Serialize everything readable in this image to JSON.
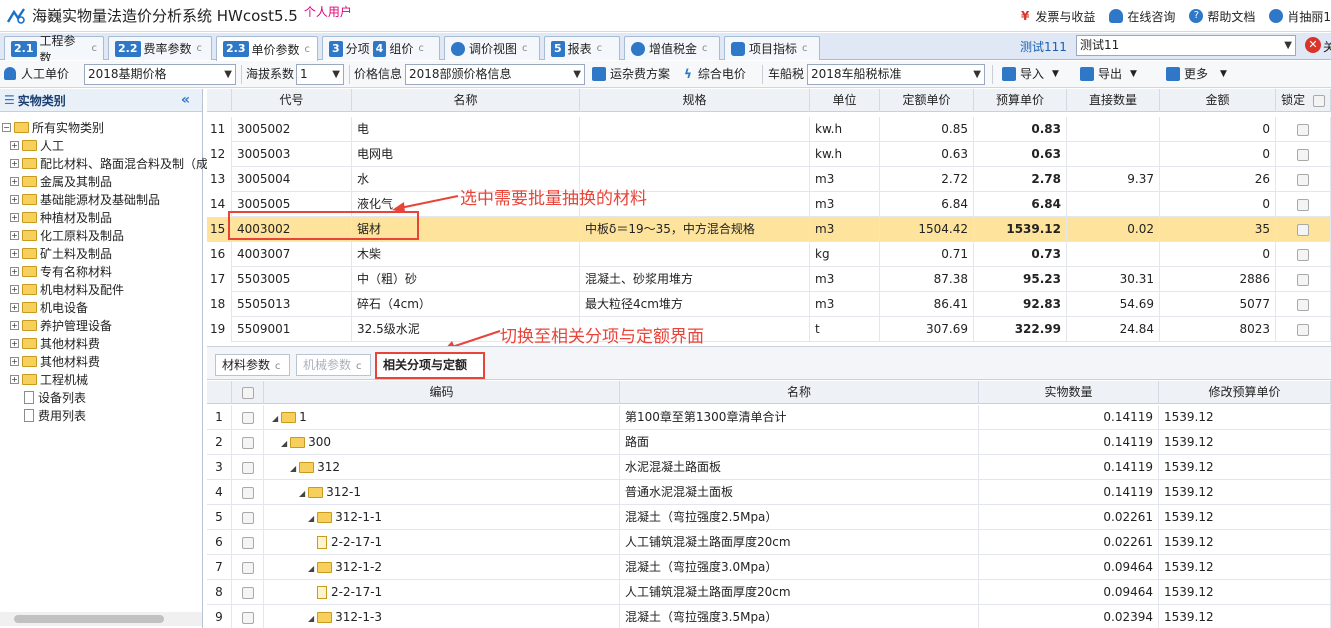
{
  "titlebar": {
    "app_title": "海巍实物量法造价分析系统 HWcost5.5",
    "user_type": "个人用户",
    "links": [
      {
        "label": "发票与收益",
        "icon": "yen-icon"
      },
      {
        "label": "在线咨询",
        "icon": "chat-icon"
      },
      {
        "label": "帮助文档",
        "icon": "help-icon"
      },
      {
        "label": "肖抽丽1",
        "icon": "user-icon"
      }
    ]
  },
  "tabs": [
    {
      "num": "2.1",
      "label": "工程参数",
      "ref": "c"
    },
    {
      "num": "2.2",
      "label": "费率参数",
      "ref": "c"
    },
    {
      "num": "2.3",
      "label": "单价参数",
      "ref": "c"
    },
    {
      "num": "3",
      "label": "分项",
      "num2": "4",
      "label2": "组价",
      "ref": "c"
    },
    {
      "label": "调价视图",
      "ref": "c"
    },
    {
      "num": "5",
      "label": "报表",
      "ref": "c"
    },
    {
      "label": "增值税金",
      "ref": "c"
    },
    {
      "label": "项目指标",
      "ref": "c"
    }
  ],
  "project": {
    "label": "测试111",
    "value": "测试11",
    "close_label": "关"
  },
  "toolbar": {
    "labor_price_label": "人工单价",
    "labor_price_value": "2018基期价格",
    "altitude_label": "海拔系数",
    "altitude_value": "1",
    "price_info_label": "价格信息",
    "price_info_value": "2018部颁价格信息",
    "transport_label": "运杂费方案",
    "power_label": "综合电价",
    "vehicle_tax_label": "车船税",
    "vehicle_tax_value": "2018车船税标准",
    "import_label": "导入",
    "export_label": "导出",
    "more_label": "更多"
  },
  "left_panel": {
    "header": "实物类别",
    "tree": [
      {
        "label": "所有实物类别",
        "level": 0,
        "type": "root"
      },
      {
        "label": "人工",
        "level": 1,
        "type": "folder"
      },
      {
        "label": "配比材料、路面混合料及制（成",
        "level": 1,
        "type": "folder"
      },
      {
        "label": "金属及其制品",
        "level": 1,
        "type": "folder"
      },
      {
        "label": "基础能源材及基础制品",
        "level": 1,
        "type": "folder"
      },
      {
        "label": "种植材及制品",
        "level": 1,
        "type": "folder"
      },
      {
        "label": "化工原料及制品",
        "level": 1,
        "type": "folder"
      },
      {
        "label": "矿土料及制品",
        "level": 1,
        "type": "folder"
      },
      {
        "label": "专有名称材料",
        "level": 1,
        "type": "folder"
      },
      {
        "label": "机电材料及配件",
        "level": 1,
        "type": "folder"
      },
      {
        "label": "机电设备",
        "level": 1,
        "type": "folder"
      },
      {
        "label": "养护管理设备",
        "level": 1,
        "type": "folder"
      },
      {
        "label": "其他材料费",
        "level": 1,
        "type": "folder"
      },
      {
        "label": "其他材料费",
        "level": 1,
        "type": "folder"
      },
      {
        "label": "工程机械",
        "level": 1,
        "type": "folder"
      },
      {
        "label": "设备列表",
        "level": 1,
        "type": "doc"
      },
      {
        "label": "费用列表",
        "level": 1,
        "type": "doc"
      }
    ]
  },
  "upper_grid": {
    "columns": [
      "代号",
      "名称",
      "规格",
      "单位",
      "定额单价",
      "预算单价",
      "直接数量",
      "金额",
      "锁定"
    ],
    "rows": [
      {
        "idx": "11",
        "code": "3005002",
        "name": "电",
        "spec": "",
        "unit": "kw.h",
        "quota": "0.85",
        "budget": "0.83",
        "qty": "",
        "amount": "0"
      },
      {
        "idx": "12",
        "code": "3005003",
        "name": "电网电",
        "spec": "",
        "unit": "kw.h",
        "quota": "0.63",
        "budget": "0.63",
        "qty": "",
        "amount": "0"
      },
      {
        "idx": "13",
        "code": "3005004",
        "name": "水",
        "spec": "",
        "unit": "m3",
        "quota": "2.72",
        "budget": "2.78",
        "qty": "9.37",
        "amount": "26"
      },
      {
        "idx": "14",
        "code": "3005005",
        "name": "液化气",
        "spec": "",
        "unit": "m3",
        "quota": "6.84",
        "budget": "6.84",
        "qty": "",
        "amount": "0"
      },
      {
        "idx": "15",
        "code": "4003002",
        "name": "锯材",
        "spec": "中板δ＝19～35，中方混合规格",
        "unit": "m3",
        "quota": "1504.42",
        "budget": "1539.12",
        "qty": "0.02",
        "amount": "35"
      },
      {
        "idx": "16",
        "code": "4003007",
        "name": "木柴",
        "spec": "",
        "unit": "kg",
        "quota": "0.71",
        "budget": "0.73",
        "qty": "",
        "amount": "0"
      },
      {
        "idx": "17",
        "code": "5503005",
        "name": "中（粗）砂",
        "spec": "混凝土、砂浆用堆方",
        "unit": "m3",
        "quota": "87.38",
        "budget": "95.23",
        "qty": "30.31",
        "amount": "2886"
      },
      {
        "idx": "18",
        "code": "5505013",
        "name": "碎石（4cm）",
        "spec": "最大粒径4cm堆方",
        "unit": "m3",
        "quota": "86.41",
        "budget": "92.83",
        "qty": "54.69",
        "amount": "5077"
      },
      {
        "idx": "19",
        "code": "5509001",
        "name": "32.5级水泥",
        "spec": "",
        "unit": "t",
        "quota": "307.69",
        "budget": "322.99",
        "qty": "24.84",
        "amount": "8023"
      }
    ]
  },
  "annotations": {
    "select_note": "选中需要批量抽换的材料",
    "switch_note": "切换至相关分项与定额界面"
  },
  "lower_tabs": [
    {
      "label": "材料参数",
      "ref": "c",
      "state": "normal"
    },
    {
      "label": "机械参数",
      "ref": "c",
      "state": "disabled"
    },
    {
      "label": "相关分项与定额",
      "ref": "",
      "state": "active"
    }
  ],
  "lower_grid": {
    "columns": [
      "编码",
      "名称",
      "实物数量",
      "修改预算单价"
    ],
    "rows": [
      {
        "idx": "1",
        "code": "1",
        "name": "第100章至第1300章清单合计",
        "qty": "0.14119",
        "price": "1539.12",
        "depth": 0,
        "type": "folder"
      },
      {
        "idx": "2",
        "code": "300",
        "name": "路面",
        "qty": "0.14119",
        "price": "1539.12",
        "depth": 1,
        "type": "folder"
      },
      {
        "idx": "3",
        "code": "312",
        "name": "水泥混凝土路面板",
        "qty": "0.14119",
        "price": "1539.12",
        "depth": 2,
        "type": "folder"
      },
      {
        "idx": "4",
        "code": "312-1",
        "name": "普通水泥混凝土面板",
        "qty": "0.14119",
        "price": "1539.12",
        "depth": 3,
        "type": "folder"
      },
      {
        "idx": "5",
        "code": "312-1-1",
        "name": "混凝土（弯拉强度2.5Mpa）",
        "qty": "0.02261",
        "price": "1539.12",
        "depth": 4,
        "type": "folder"
      },
      {
        "idx": "6",
        "code": "2-2-17-1",
        "name": "人工铺筑混凝土路面厚度20cm",
        "qty": "0.02261",
        "price": "1539.12",
        "depth": 5,
        "type": "doc"
      },
      {
        "idx": "7",
        "code": "312-1-2",
        "name": "混凝土（弯拉强度3.0Mpa）",
        "qty": "0.09464",
        "price": "1539.12",
        "depth": 4,
        "type": "folder"
      },
      {
        "idx": "8",
        "code": "2-2-17-1",
        "name": "人工铺筑混凝土路面厚度20cm",
        "qty": "0.09464",
        "price": "1539.12",
        "depth": 5,
        "type": "doc"
      },
      {
        "idx": "9",
        "code": "312-1-3",
        "name": "混凝土（弯拉强度3.5Mpa）",
        "qty": "0.02394",
        "price": "1539.12",
        "depth": 4,
        "type": "folder"
      }
    ]
  },
  "colors": {
    "accent": "#2f77c7",
    "selected_row": "#fde39c",
    "annotation": "#e8443a",
    "user_type": "#e0007a"
  }
}
